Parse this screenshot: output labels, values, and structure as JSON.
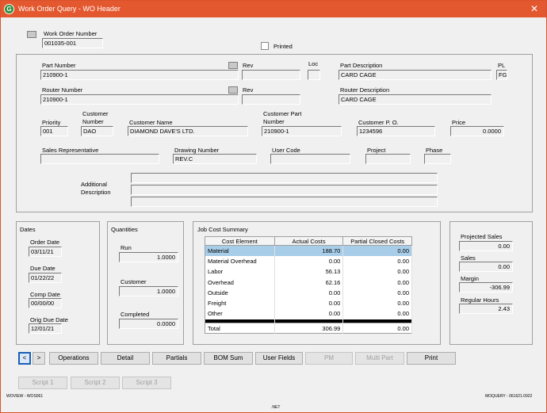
{
  "window": {
    "title": "Work Order Query - WO Header",
    "app_icon": "G",
    "close": "✕"
  },
  "header": {
    "wo_label": "Work Order Number",
    "wo_value": "001035-001",
    "printed_label": "Printed",
    "part_number_label": "Part Number",
    "part_number": "210900-1",
    "rev_label": "Rev",
    "rev_value": "",
    "loc_label": "Loc",
    "loc_value": "",
    "part_desc_label": "Part Description",
    "part_desc": "CARD CAGE",
    "pl_label": "PL",
    "pl_value": "FG",
    "router_label": "Router Number",
    "router_number": "210900-1",
    "router_rev_label": "Rev",
    "router_rev": "",
    "router_desc_label": "Router Description",
    "router_desc": "CARD CAGE",
    "priority_label": "Priority",
    "priority": "001",
    "cust_num_label": "Customer Number",
    "cust_num": "DAO",
    "cust_name_label": "Customer Name",
    "cust_name": "DIAMOND DAVE'S LTD.",
    "cust_part_label": "Customer Part Number",
    "cust_part": "210900-1",
    "cust_po_label": "Customer P. O.",
    "cust_po": "1234596",
    "price_label": "Price",
    "price": "0.0000",
    "sales_rep_label": "Sales Representative",
    "sales_rep": "",
    "drawing_label": "Drawing Number",
    "drawing": "REV.C",
    "user_code_label": "User Code",
    "user_code": "",
    "project_label": "Project",
    "project": "",
    "phase_label": "Phase",
    "phase": "",
    "add_desc_label": "Additional Description"
  },
  "dates": {
    "title": "Dates",
    "order_label": "Order Date",
    "order": "03/11/21",
    "due_label": "Due Date",
    "due": "01/22/22",
    "comp_label": "Comp Date",
    "comp": "00/00/00",
    "orig_due_label": "Orig Due Date",
    "orig_due": "12/01/21"
  },
  "quantities": {
    "title": "Quantities",
    "run_label": "Run",
    "run": "1.0000",
    "customer_label": "Customer",
    "customer": "1.0000",
    "completed_label": "Completed",
    "completed": "0.0000"
  },
  "job_cost": {
    "title": "Job Cost Summary",
    "headers": [
      "Cost Element",
      "Actual Costs",
      "Partial Closed Costs"
    ],
    "rows": [
      [
        "Material",
        "188.70",
        "0.00"
      ],
      [
        "Material Overhead",
        "0.00",
        "0.00"
      ],
      [
        "Labor",
        "56.13",
        "0.00"
      ],
      [
        "Overhead",
        "62.16",
        "0.00"
      ],
      [
        "Outside",
        "0.00",
        "0.00"
      ],
      [
        "Freight",
        "0.00",
        "0.00"
      ],
      [
        "Other",
        "0.00",
        "0.00"
      ]
    ],
    "total": [
      "Total",
      "306.99",
      "0.00"
    ]
  },
  "summary": {
    "proj_sales_label": "Projected Sales",
    "proj_sales": "0.00",
    "sales_label": "Sales",
    "sales": "0.00",
    "margin_label": "Margin",
    "margin": "-306.99",
    "reg_hours_label": "Regular Hours",
    "reg_hours": "2.43"
  },
  "buttons": {
    "prev": "<",
    "next": ">",
    "operations": "Operations",
    "detail": "Detail",
    "partials": "Partials",
    "bom_sum": "BOM Sum",
    "user_fields": "User Fields",
    "pm": "PM",
    "multi_part": "Multi Part",
    "print": "Print",
    "script1": "Script 1",
    "script2": "Script 2",
    "script3": "Script 3"
  },
  "footer": {
    "left": "WOVIEW - WOS061",
    "center": ".NET",
    "right": "MOQUERY - 061621.0922"
  }
}
